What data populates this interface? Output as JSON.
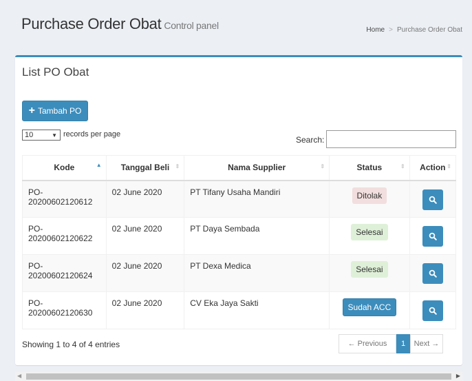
{
  "header": {
    "title": "Purchase Order Obat",
    "subtitle": "Control panel",
    "breadcrumb": [
      "Home",
      "Purchase Order Obat"
    ]
  },
  "box": {
    "title": "List PO Obat",
    "add_label": "Tambah PO"
  },
  "length_menu": {
    "value": "10",
    "label": "records per page"
  },
  "search": {
    "label": "Search:",
    "value": ""
  },
  "table": {
    "columns": [
      "Kode",
      "Tanggal Beli",
      "Nama Supplier",
      "Status",
      "Action"
    ],
    "rows": [
      {
        "kode": [
          "PO-",
          "20200602120612"
        ],
        "tanggal": "02 June 2020",
        "supplier": "PT Tifany Usaha Mandiri",
        "status": "Ditolak"
      },
      {
        "kode": [
          "PO-",
          "20200602120622"
        ],
        "tanggal": "02 June 2020",
        "supplier": "PT Daya Sembada",
        "status": "Selesai"
      },
      {
        "kode": [
          "PO-",
          "20200602120624"
        ],
        "tanggal": "02 June 2020",
        "supplier": "PT Dexa Medica",
        "status": "Selesai"
      },
      {
        "kode": [
          "PO-",
          "20200602120630"
        ],
        "tanggal": "02 June 2020",
        "supplier": "CV Eka Jaya Sakti",
        "status": "Sudah ACC"
      }
    ]
  },
  "footer": {
    "info": "Showing 1 to 4 of 4 entries",
    "prev": "← Previous",
    "page": "1",
    "next": "Next →"
  },
  "colors": {
    "primary": "#3c8dbc",
    "danger_bg": "#f2dede",
    "success_bg": "#dff0d8"
  },
  "icons": [
    "plus-icon",
    "search-icon",
    "sort-icon",
    "caret-down-icon"
  ]
}
